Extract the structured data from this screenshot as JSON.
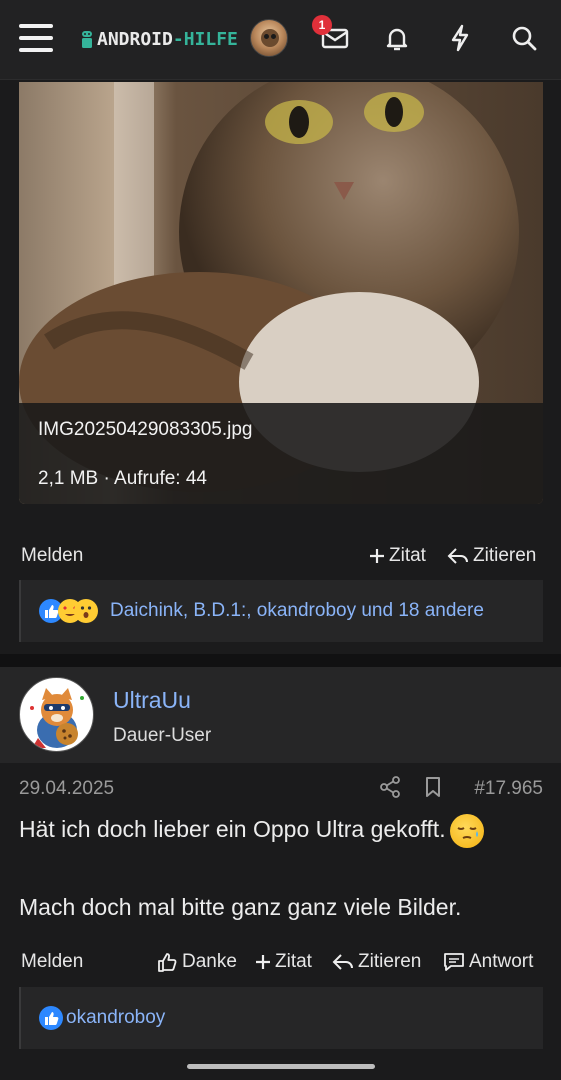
{
  "header": {
    "menu_icon": "hamburger-menu-icon",
    "logo_text_a": "ANDROID",
    "logo_text_dash": "-",
    "logo_text_b": "HILFE",
    "inbox_badge": "1",
    "icons": [
      "inbox-icon",
      "bell-icon",
      "bolt-icon",
      "search-icon"
    ],
    "accent_color": "#35b49a"
  },
  "attachment": {
    "filename": "IMG20250429083305.jpg",
    "meta": "2,1 MB · Aufrufe: 44"
  },
  "post1_actions": {
    "report": "Melden",
    "quote_add": "Zitat",
    "quote": "Zitieren"
  },
  "post1_reactions": {
    "names": "Daichink, B.D.1:, okandroboy und 18 andere"
  },
  "post2": {
    "username": "UltraUu",
    "user_title": "Dauer-User",
    "date": "29.04.2025",
    "post_number": "#17.965",
    "line1": "Hät ich doch lieber ein Oppo Ultra gekofft.",
    "line2": "Mach doch mal bitte ganz ganz viele Bilder.",
    "actions": {
      "report": "Melden",
      "like": "Danke",
      "quote_add": "Zitat",
      "quote": "Zitieren",
      "reply": "Antwort"
    },
    "reactions": "okandroboy"
  },
  "colors": {
    "link": "#8ab4f8",
    "background": "#1b1b1c",
    "badge": "#e0303a"
  }
}
